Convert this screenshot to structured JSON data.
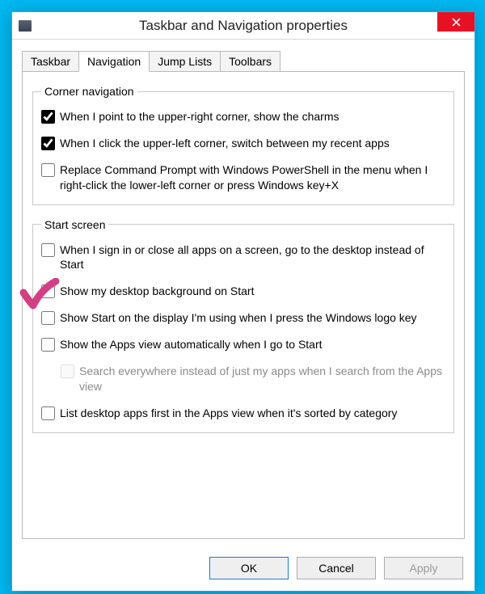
{
  "window": {
    "title": "Taskbar and Navigation properties"
  },
  "tabs": [
    "Taskbar",
    "Navigation",
    "Jump Lists",
    "Toolbars"
  ],
  "active_tab_index": 1,
  "groups": {
    "corner": {
      "legend": "Corner navigation",
      "items": [
        {
          "checked": true,
          "label": "When I point to the upper-right corner, show the charms"
        },
        {
          "checked": true,
          "label": "When I click the upper-left corner, switch between my recent apps"
        },
        {
          "checked": false,
          "label": "Replace Command Prompt with Windows PowerShell in the menu when I right-click the lower-left corner or press Windows key+X"
        }
      ]
    },
    "start": {
      "legend": "Start screen",
      "items": [
        {
          "checked": false,
          "label": "When I sign in or close all apps on a screen, go to the desktop instead of Start"
        },
        {
          "checked": false,
          "label": "Show my desktop background on Start"
        },
        {
          "checked": false,
          "label": "Show Start on the display I'm using when I press the Windows logo key"
        },
        {
          "checked": false,
          "label": "Show the Apps view automatically when I go to Start"
        },
        {
          "checked": false,
          "label": "Search everywhere instead of just my apps when I search from the Apps view",
          "disabled": true,
          "indent": true
        },
        {
          "checked": false,
          "label": "List desktop apps first in the Apps view when it's sorted by category"
        }
      ]
    }
  },
  "buttons": {
    "ok": "OK",
    "cancel": "Cancel",
    "apply": "Apply"
  },
  "annotation_color": "#d23f82"
}
